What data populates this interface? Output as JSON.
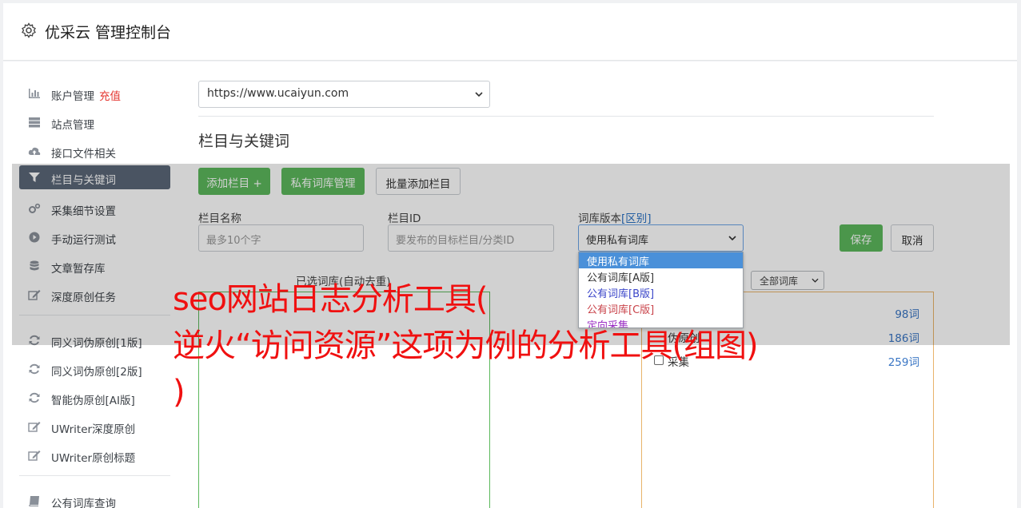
{
  "header": {
    "title": "优采云 管理控制台"
  },
  "sidebar": {
    "items": [
      {
        "label": "账户管理",
        "badge": "充值",
        "icon": "bar-chart-icon"
      },
      {
        "label": "站点管理",
        "icon": "server-icon"
      },
      {
        "label": "接口文件相关",
        "icon": "cloud-upload-icon"
      },
      {
        "label": "栏目与关键词",
        "icon": "filter-icon",
        "active": true
      },
      {
        "label": "采集细节设置",
        "icon": "gears-icon"
      },
      {
        "label": "手动运行测试",
        "icon": "play-circle-icon"
      },
      {
        "label": "文章暂存库",
        "icon": "database-icon"
      },
      {
        "label": "深度原创任务",
        "icon": "edit-icon"
      },
      {
        "label": "同义词伪原创[1版]",
        "icon": "refresh-icon"
      },
      {
        "label": "同义词伪原创[2版]",
        "icon": "refresh-icon"
      },
      {
        "label": "智能伪原创[AI版]",
        "icon": "refresh-icon"
      },
      {
        "label": "UWriter深度原创",
        "icon": "edit-icon"
      },
      {
        "label": "UWriter原创标题",
        "icon": "edit-icon"
      },
      {
        "label": "公有词库查询",
        "icon": "book-icon"
      }
    ]
  },
  "site_select": {
    "value": "https://www.ucaiyun.com"
  },
  "section_title": "栏目与关键词",
  "toolbar": {
    "add_column": "添加栏目 +",
    "private_lib": "私有词库管理",
    "batch_add": "批量添加栏目"
  },
  "form": {
    "name_label": "栏目名称",
    "name_placeholder": "最多10个字",
    "id_label": "栏目ID",
    "id_placeholder": "要发布的目标栏目/分类ID",
    "version_label": "词库版本",
    "version_link": "[区别]",
    "version_value": "使用私有词库",
    "save": "保存",
    "cancel": "取消"
  },
  "dropdown": {
    "options": [
      {
        "label": "使用私有词库",
        "color": "#ffffff"
      },
      {
        "label": "公有词库[A版]",
        "color": "#333333"
      },
      {
        "label": "公有词库[B版]",
        "color": "#3b46c9"
      },
      {
        "label": "公有词库[C版]",
        "color": "#c9434a"
      },
      {
        "label": "定向采集",
        "color": "#9b2fc4"
      }
    ]
  },
  "panels": {
    "selected_label": "已选词库(自动去重)",
    "filter_value": "全部词库",
    "libs": [
      {
        "name": "",
        "count": "98词"
      },
      {
        "name": "伪原创",
        "count": "186词"
      },
      {
        "name": "采集",
        "count": "259词"
      }
    ]
  },
  "watermark": {
    "line1": "seo网站日志分析工具(",
    "line2": "逆火“访问资源”这项为例的分析工具(组图)",
    "line3": ")"
  },
  "colors": {
    "accent_green": "#5cb85c",
    "active_nav": "#5b6778",
    "link_blue": "#2a72c4",
    "watermark_red": "#f01010"
  }
}
